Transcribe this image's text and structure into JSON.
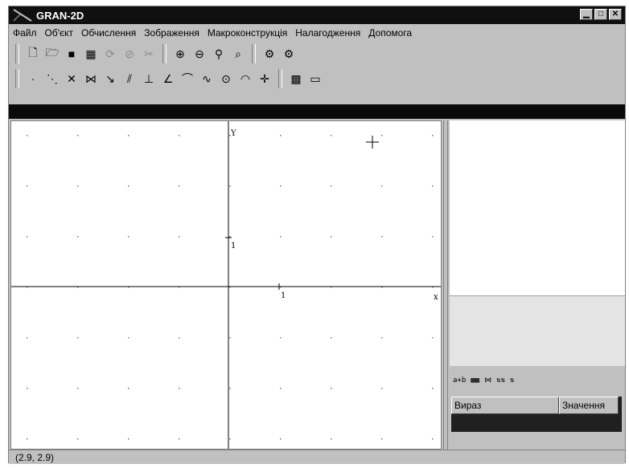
{
  "window": {
    "title": "GRAN-2D",
    "buttons": [
      "minimize-icon",
      "maximize-icon",
      "close-icon"
    ]
  },
  "menu": [
    "Файл",
    "Об'єкт",
    "Обчислення",
    "Зображення",
    "Макроконструкція",
    "Налагодження",
    "Допомога"
  ],
  "toolbar1": [
    "new-file-icon",
    "open-folder-icon",
    "save-disk-icon",
    "table-icon",
    "rotate-icon",
    "forbid-icon",
    "cut-scissors-icon",
    "zoom-in-icon",
    "zoom-out-icon",
    "zoom-icon",
    "zoom-fit-icon",
    "gears-icon",
    "gears2-icon"
  ],
  "toolbar2": [
    "point-icon",
    "segment-icon",
    "crossing-lines-icon",
    "intersect-icon",
    "ray-icon",
    "parallel-icon",
    "perpendicular-icon",
    "angle-icon",
    "curve-icon",
    "wave-icon",
    "circle-icon",
    "arc-icon",
    "star-point-icon",
    "grid-icon",
    "ruler-icon"
  ],
  "plot": {
    "y_axis_label": "Y",
    "x_axis_label": "x",
    "unit_x": "1",
    "unit_y": "1"
  },
  "table": {
    "col_expr": "Вираз",
    "col_value": "Значення"
  },
  "status": {
    "coords": "(2.9, 2.9)"
  }
}
